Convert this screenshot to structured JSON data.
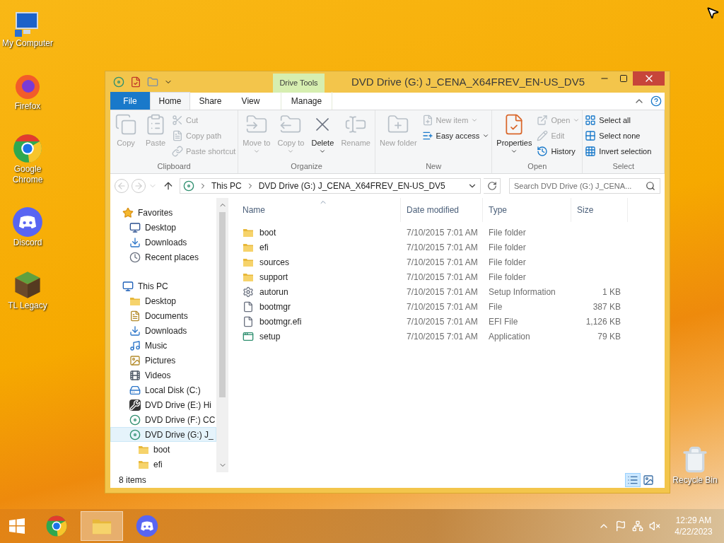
{
  "desktop_icons": [
    {
      "label": "My Computer",
      "kind": "computer"
    },
    {
      "label": "Firefox",
      "kind": "firefox"
    },
    {
      "label": "Google Chrome",
      "kind": "chrome"
    },
    {
      "label": "Discord",
      "kind": "discord"
    },
    {
      "label": "TL Legacy",
      "kind": "block"
    }
  ],
  "recycle_bin": {
    "label": "Recycle Bin"
  },
  "window": {
    "title": "DVD Drive (G:) J_CENA_X64FREV_EN-US_DV5",
    "context_group": "Drive Tools",
    "ribbon_tabs": [
      {
        "label": "File",
        "kind": "file",
        "selected": false
      },
      {
        "label": "Home",
        "kind": "tab",
        "selected": true
      },
      {
        "label": "Share",
        "kind": "tab",
        "selected": false
      },
      {
        "label": "View",
        "kind": "tab",
        "selected": false
      },
      {
        "label": "Manage",
        "kind": "context",
        "selected": false
      }
    ],
    "ribbon_groups": [
      {
        "label": "Clipboard",
        "commands": [
          {
            "label": "Copy",
            "kind": "large",
            "disabled": true,
            "dropdown": false
          },
          {
            "label": "Paste",
            "kind": "large",
            "disabled": true,
            "dropdown": false
          },
          {
            "label": "Cut",
            "kind": "small",
            "disabled": true,
            "dropdown": false
          },
          {
            "label": "Copy path",
            "kind": "small",
            "disabled": true,
            "dropdown": false
          },
          {
            "label": "Paste shortcut",
            "kind": "small",
            "disabled": true,
            "dropdown": false
          }
        ]
      },
      {
        "label": "Organize",
        "commands": [
          {
            "label": "Move to",
            "kind": "large",
            "disabled": true,
            "dropdown": true
          },
          {
            "label": "Copy to",
            "kind": "large",
            "disabled": true,
            "dropdown": true
          },
          {
            "label": "Delete",
            "kind": "large",
            "disabled": false,
            "dropdown": true
          },
          {
            "label": "Rename",
            "kind": "large",
            "disabled": true,
            "dropdown": false
          }
        ]
      },
      {
        "label": "New",
        "commands": [
          {
            "label": "New folder",
            "kind": "large",
            "disabled": true,
            "dropdown": false
          },
          {
            "label": "New item",
            "kind": "small",
            "disabled": true,
            "dropdown": true
          },
          {
            "label": "Easy access",
            "kind": "small",
            "disabled": false,
            "dropdown": true
          }
        ]
      },
      {
        "label": "Open",
        "commands": [
          {
            "label": "Properties",
            "kind": "large",
            "disabled": false,
            "dropdown": true
          },
          {
            "label": "Open",
            "kind": "small",
            "disabled": true,
            "dropdown": true
          },
          {
            "label": "Edit",
            "kind": "small",
            "disabled": true,
            "dropdown": false
          },
          {
            "label": "History",
            "kind": "small",
            "disabled": false,
            "dropdown": false
          }
        ]
      },
      {
        "label": "Select",
        "commands": [
          {
            "label": "Select all",
            "kind": "small",
            "disabled": false,
            "dropdown": false
          },
          {
            "label": "Select none",
            "kind": "small",
            "disabled": false,
            "dropdown": false
          },
          {
            "label": "Invert selection",
            "kind": "small",
            "disabled": false,
            "dropdown": false
          }
        ]
      }
    ],
    "address": {
      "segments": [
        "This PC",
        "DVD Drive (G:) J_CENA_X64FREV_EN-US_DV5"
      ]
    },
    "search": {
      "placeholder": "Search DVD Drive (G:) J_CENA..."
    },
    "nav": [
      {
        "label": "Favorites",
        "kind": "star",
        "selected": false,
        "children": [
          {
            "label": "Desktop",
            "kind": "desktop",
            "selected": false
          },
          {
            "label": "Downloads",
            "kind": "downloads",
            "selected": false
          },
          {
            "label": "Recent places",
            "kind": "recent",
            "selected": false
          }
        ]
      },
      {
        "label": "This PC",
        "kind": "pc",
        "selected": false,
        "children": [
          {
            "label": "Desktop",
            "kind": "desktop-folder",
            "selected": false
          },
          {
            "label": "Documents",
            "kind": "documents",
            "selected": false
          },
          {
            "label": "Downloads",
            "kind": "downloads",
            "selected": false
          },
          {
            "label": "Music",
            "kind": "music",
            "selected": false
          },
          {
            "label": "Pictures",
            "kind": "pictures",
            "selected": false
          },
          {
            "label": "Videos",
            "kind": "videos",
            "selected": false
          },
          {
            "label": "Local Disk (C:)",
            "kind": "disk",
            "selected": false
          },
          {
            "label": "DVD Drive (E:) Hi",
            "kind": "tools-disc",
            "selected": false
          },
          {
            "label": "DVD Drive (F:) CC",
            "kind": "dvd",
            "selected": false
          },
          {
            "label": "DVD Drive (G:) J_",
            "kind": "dvd",
            "selected": true,
            "children": [
              {
                "label": "boot",
                "kind": "folder",
                "selected": false
              },
              {
                "label": "efi",
                "kind": "folder",
                "selected": false
              }
            ]
          }
        ]
      }
    ],
    "columns": [
      {
        "label": "Name",
        "sorted": true
      },
      {
        "label": "Date modified",
        "sorted": false
      },
      {
        "label": "Type",
        "sorted": false
      },
      {
        "label": "Size",
        "sorted": false
      }
    ],
    "rows": [
      {
        "name": "boot",
        "kind": "folder",
        "date": "7/10/2015 7:01 AM",
        "type": "File folder"
      },
      {
        "name": "efi",
        "kind": "folder",
        "date": "7/10/2015 7:01 AM",
        "type": "File folder"
      },
      {
        "name": "sources",
        "kind": "folder",
        "date": "7/10/2015 7:01 AM",
        "type": "File folder"
      },
      {
        "name": "support",
        "kind": "folder",
        "date": "7/10/2015 7:01 AM",
        "type": "File folder"
      },
      {
        "name": "autorun",
        "kind": "settings",
        "date": "7/10/2015 7:01 AM",
        "type": "Setup Information",
        "size": "1 KB"
      },
      {
        "name": "bootmgr",
        "kind": "file",
        "date": "7/10/2015 7:01 AM",
        "type": "File",
        "size": "387 KB"
      },
      {
        "name": "bootmgr.efi",
        "kind": "file",
        "date": "7/10/2015 7:01 AM",
        "type": "EFI File",
        "size": "1,126 KB"
      },
      {
        "name": "setup",
        "kind": "app",
        "date": "7/10/2015 7:01 AM",
        "type": "Application",
        "size": "79 KB"
      }
    ],
    "status": "8 items",
    "views": [
      {
        "kind": "details",
        "selected": true
      },
      {
        "kind": "large-icons",
        "selected": false
      }
    ]
  },
  "taskbar": {
    "items": [
      {
        "kind": "chrome",
        "selected": false
      },
      {
        "kind": "explorer",
        "selected": true
      },
      {
        "kind": "discord",
        "selected": false
      }
    ],
    "time": "12:29 AM",
    "date": "4/22/2023"
  }
}
